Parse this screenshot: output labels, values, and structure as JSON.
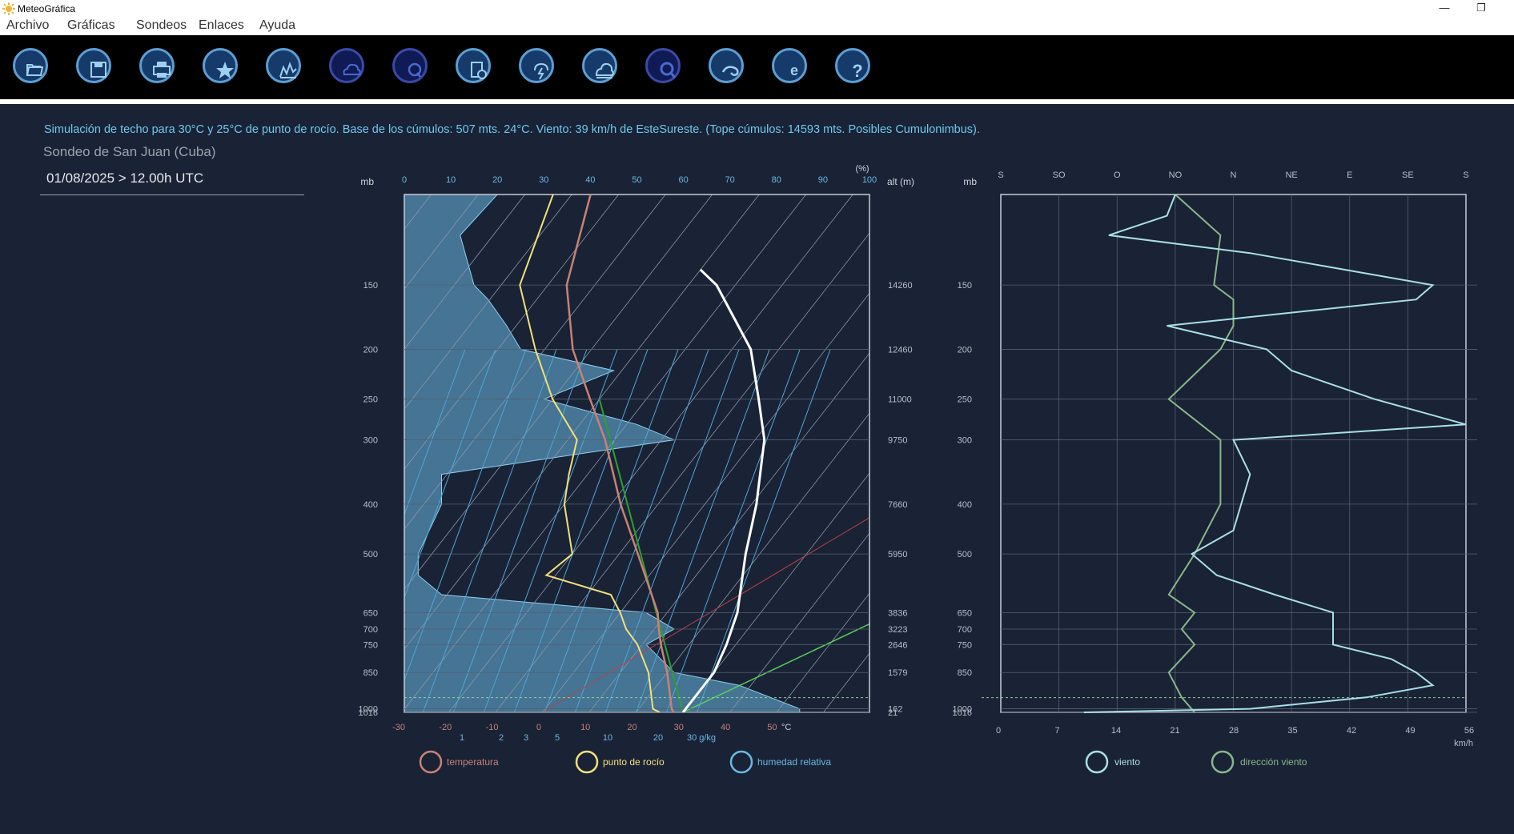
{
  "window": {
    "title": "MeteoGráfica",
    "minimize": "—",
    "restore": "❐"
  },
  "menu": [
    "Archivo",
    "Gráficas",
    "Sondeos",
    "Enlaces",
    "Ayuda"
  ],
  "toolbar": [
    {
      "name": "open-folder-icon"
    },
    {
      "name": "save-icon"
    },
    {
      "name": "print-icon"
    },
    {
      "name": "favorite-star-icon"
    },
    {
      "name": "sounding-chart-icon"
    },
    {
      "name": "cloud-icon"
    },
    {
      "name": "q-icon"
    },
    {
      "name": "document-clock-icon"
    },
    {
      "name": "storm-icon"
    },
    {
      "name": "cloud-layers-icon"
    },
    {
      "name": "search-icon"
    },
    {
      "name": "wind-icon"
    },
    {
      "name": "info-e-icon"
    },
    {
      "name": "help-icon"
    }
  ],
  "info": {
    "simulation": "Simulación de techo para 30°C y 25°C de punto de rocío. Base de los cúmulos: 507 mts. 24°C.  Viento: 39 km/h de EsteSureste. (Tope cúmulos: 14593 mts. Posibles Cumulonimbus).",
    "station": "Sondeo de San Juan (Cuba)",
    "datetime": "01/08/2025 > 12.00h UTC"
  },
  "chart_data": [
    {
      "type": "line",
      "pressure_label": "mb",
      "alt_label": "alt (m)",
      "rh_label": "(%)",
      "rh_ticks": [
        0,
        10,
        20,
        30,
        40,
        50,
        60,
        70,
        80,
        90,
        100
      ],
      "pressure_ticks": [
        {
          "p": 150,
          "label": "150",
          "alt": "14260"
        },
        {
          "p": 200,
          "label": "200",
          "alt": "12460"
        },
        {
          "p": 250,
          "label": "250",
          "alt": "11000"
        },
        {
          "p": 300,
          "label": "300",
          "alt": "9750"
        },
        {
          "p": 400,
          "label": "400",
          "alt": "7660"
        },
        {
          "p": 500,
          "label": "500",
          "alt": "5950"
        },
        {
          "p": 650,
          "label": "650",
          "alt": "3836"
        },
        {
          "p": 700,
          "label": "700",
          "alt": "3223"
        },
        {
          "p": 750,
          "label": "750",
          "alt": "2646"
        },
        {
          "p": 850,
          "label": "850",
          "alt": "1579"
        },
        {
          "p": 1000,
          "label": "1000",
          "alt": "162"
        },
        {
          "p": 1016,
          "label": "1016",
          "alt": "21"
        }
      ],
      "temp_ticks": [
        "-30",
        "-20",
        "-10",
        "0",
        "10",
        "20",
        "30",
        "40",
        "50"
      ],
      "temp_unit": "°C",
      "mixing_ticks": [
        "1",
        "2",
        "3",
        "5",
        "10",
        "20",
        "30 g/kg"
      ],
      "legend": [
        "temperatura",
        "punto de rocío",
        "humedad relativa"
      ],
      "colors": {
        "temperature": "#c98272",
        "dewpoint": "#f3e07a",
        "humidity": "#6ab8e2",
        "parcel": "#ffffff",
        "moist": "#2ea02e"
      },
      "series": [
        {
          "name": "temperatura",
          "points": [
            [
              1016,
              28
            ],
            [
              1000,
              27
            ],
            [
              850,
              20
            ],
            [
              750,
              14
            ],
            [
              700,
              11
            ],
            [
              650,
              8
            ],
            [
              500,
              -6
            ],
            [
              400,
              -18
            ],
            [
              300,
              -32
            ],
            [
              250,
              -42
            ],
            [
              200,
              -54
            ],
            [
              150,
              -66
            ],
            [
              100,
              -76
            ]
          ]
        },
        {
          "name": "punto de rocío",
          "points": [
            [
              1016,
              25
            ],
            [
              1000,
              23
            ],
            [
              850,
              16
            ],
            [
              750,
              9
            ],
            [
              700,
              4
            ],
            [
              650,
              0
            ],
            [
              600,
              -5
            ],
            [
              550,
              -22
            ],
            [
              500,
              -20
            ],
            [
              400,
              -30
            ],
            [
              350,
              -34
            ],
            [
              300,
              -38
            ],
            [
              250,
              -50
            ],
            [
              200,
              -62
            ],
            [
              150,
              -76
            ],
            [
              100,
              -84
            ]
          ]
        },
        {
          "name": "parcela",
          "points": [
            [
              1016,
              30
            ],
            [
              1000,
              30
            ],
            [
              850,
              30
            ],
            [
              750,
              28
            ],
            [
              650,
              25
            ],
            [
              500,
              17
            ],
            [
              400,
              11
            ],
            [
              300,
              2
            ],
            [
              250,
              -6
            ],
            [
              200,
              -16
            ],
            [
              150,
              -34
            ],
            [
              140,
              -40
            ]
          ]
        },
        {
          "name": "humedad relativa",
          "points": [
            [
              1016,
              85
            ],
            [
              1000,
              85
            ],
            [
              900,
              72
            ],
            [
              850,
              58
            ],
            [
              750,
              52
            ],
            [
              700,
              58
            ],
            [
              650,
              52
            ],
            [
              600,
              8
            ],
            [
              550,
              3
            ],
            [
              500,
              3
            ],
            [
              400,
              8
            ],
            [
              350,
              8
            ],
            [
              300,
              58
            ],
            [
              280,
              50
            ],
            [
              250,
              30
            ],
            [
              220,
              45
            ],
            [
              200,
              25
            ],
            [
              180,
              22
            ],
            [
              160,
              18
            ],
            [
              150,
              15
            ],
            [
              120,
              12
            ],
            [
              100,
              20
            ]
          ]
        }
      ]
    },
    {
      "type": "line",
      "pressure_label": "mb",
      "direction_ticks": [
        "S",
        "SO",
        "O",
        "NO",
        "N",
        "NE",
        "E",
        "SE",
        "S"
      ],
      "speed_ticks": [
        "0",
        "7",
        "14",
        "21",
        "28",
        "35",
        "42",
        "49",
        "56"
      ],
      "speed_unit": "km/h",
      "legend": [
        "viento",
        "dirección viento"
      ],
      "colors": {
        "speed": "#a8e0e8",
        "direction": "#88b888"
      },
      "series": [
        {
          "name": "viento",
          "points": [
            [
              1016,
              10
            ],
            [
              1000,
              30
            ],
            [
              950,
              44
            ],
            [
              900,
              52
            ],
            [
              850,
              50
            ],
            [
              800,
              47
            ],
            [
              750,
              40
            ],
            [
              650,
              40
            ],
            [
              600,
              33
            ],
            [
              550,
              26
            ],
            [
              500,
              23
            ],
            [
              450,
              28
            ],
            [
              350,
              30
            ],
            [
              300,
              28
            ],
            [
              280,
              56
            ],
            [
              250,
              45
            ],
            [
              220,
              35
            ],
            [
              200,
              32
            ],
            [
              180,
              20
            ],
            [
              160,
              50
            ],
            [
              150,
              52
            ],
            [
              130,
              30
            ],
            [
              120,
              13
            ],
            [
              110,
              20
            ],
            [
              100,
              21
            ]
          ]
        },
        {
          "name": "dirección viento",
          "points": [
            [
              1016,
              330
            ],
            [
              950,
              320
            ],
            [
              850,
              310
            ],
            [
              750,
              330
            ],
            [
              700,
              320
            ],
            [
              650,
              330
            ],
            [
              600,
              310
            ],
            [
              500,
              330
            ],
            [
              400,
              350
            ],
            [
              300,
              350
            ],
            [
              250,
              310
            ],
            [
              200,
              350
            ],
            [
              180,
              360
            ],
            [
              170,
              0
            ],
            [
              160,
              360
            ],
            [
              150,
              345
            ],
            [
              120,
              350
            ],
            [
              100,
              315
            ]
          ]
        }
      ]
    }
  ]
}
